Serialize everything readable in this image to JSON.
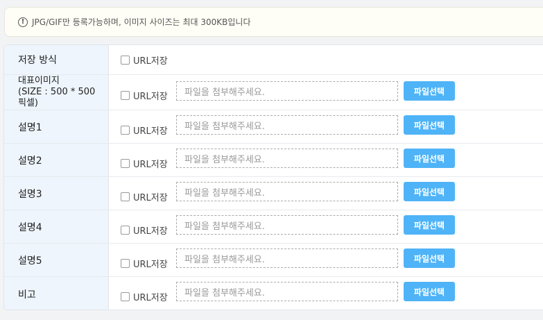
{
  "notice": {
    "icon": "exclamation-circle-icon",
    "text": "JPG/GIF만 등록가능하며, 이미지 사이즈는 최대 300KB입니다"
  },
  "rows": [
    {
      "label": "저장 방식",
      "checkbox_label": "URL저장"
    },
    {
      "label": "대표이미지\n(SIZE : 500 * 500\n픽셀)",
      "checkbox_label": "URL저장",
      "file_placeholder": "파일을 첨부해주세요.",
      "button_label": "파일선택"
    },
    {
      "label": "설명1",
      "checkbox_label": "URL저장",
      "file_placeholder": "파일을 첨부해주세요.",
      "button_label": "파일선택"
    },
    {
      "label": "설명2",
      "checkbox_label": "URL저장",
      "file_placeholder": "파일을 첨부해주세요.",
      "button_label": "파일선택"
    },
    {
      "label": "설명3",
      "checkbox_label": "URL저장",
      "file_placeholder": "파일을 첨부해주세요.",
      "button_label": "파일선택"
    },
    {
      "label": "설명4",
      "checkbox_label": "URL저장",
      "file_placeholder": "파일을 첨부해주세요.",
      "button_label": "파일선택"
    },
    {
      "label": "설명5",
      "checkbox_label": "URL저장",
      "file_placeholder": "파일을 첨부해주세요.",
      "button_label": "파일선택"
    },
    {
      "label": "비고",
      "checkbox_label": "URL저장",
      "file_placeholder": "파일을 첨부해주세요.",
      "button_label": "파일선택"
    }
  ],
  "colors": {
    "accent": "#4fb3f7",
    "label_bg": "#eef5fc",
    "notice_bg": "#fffef6"
  }
}
